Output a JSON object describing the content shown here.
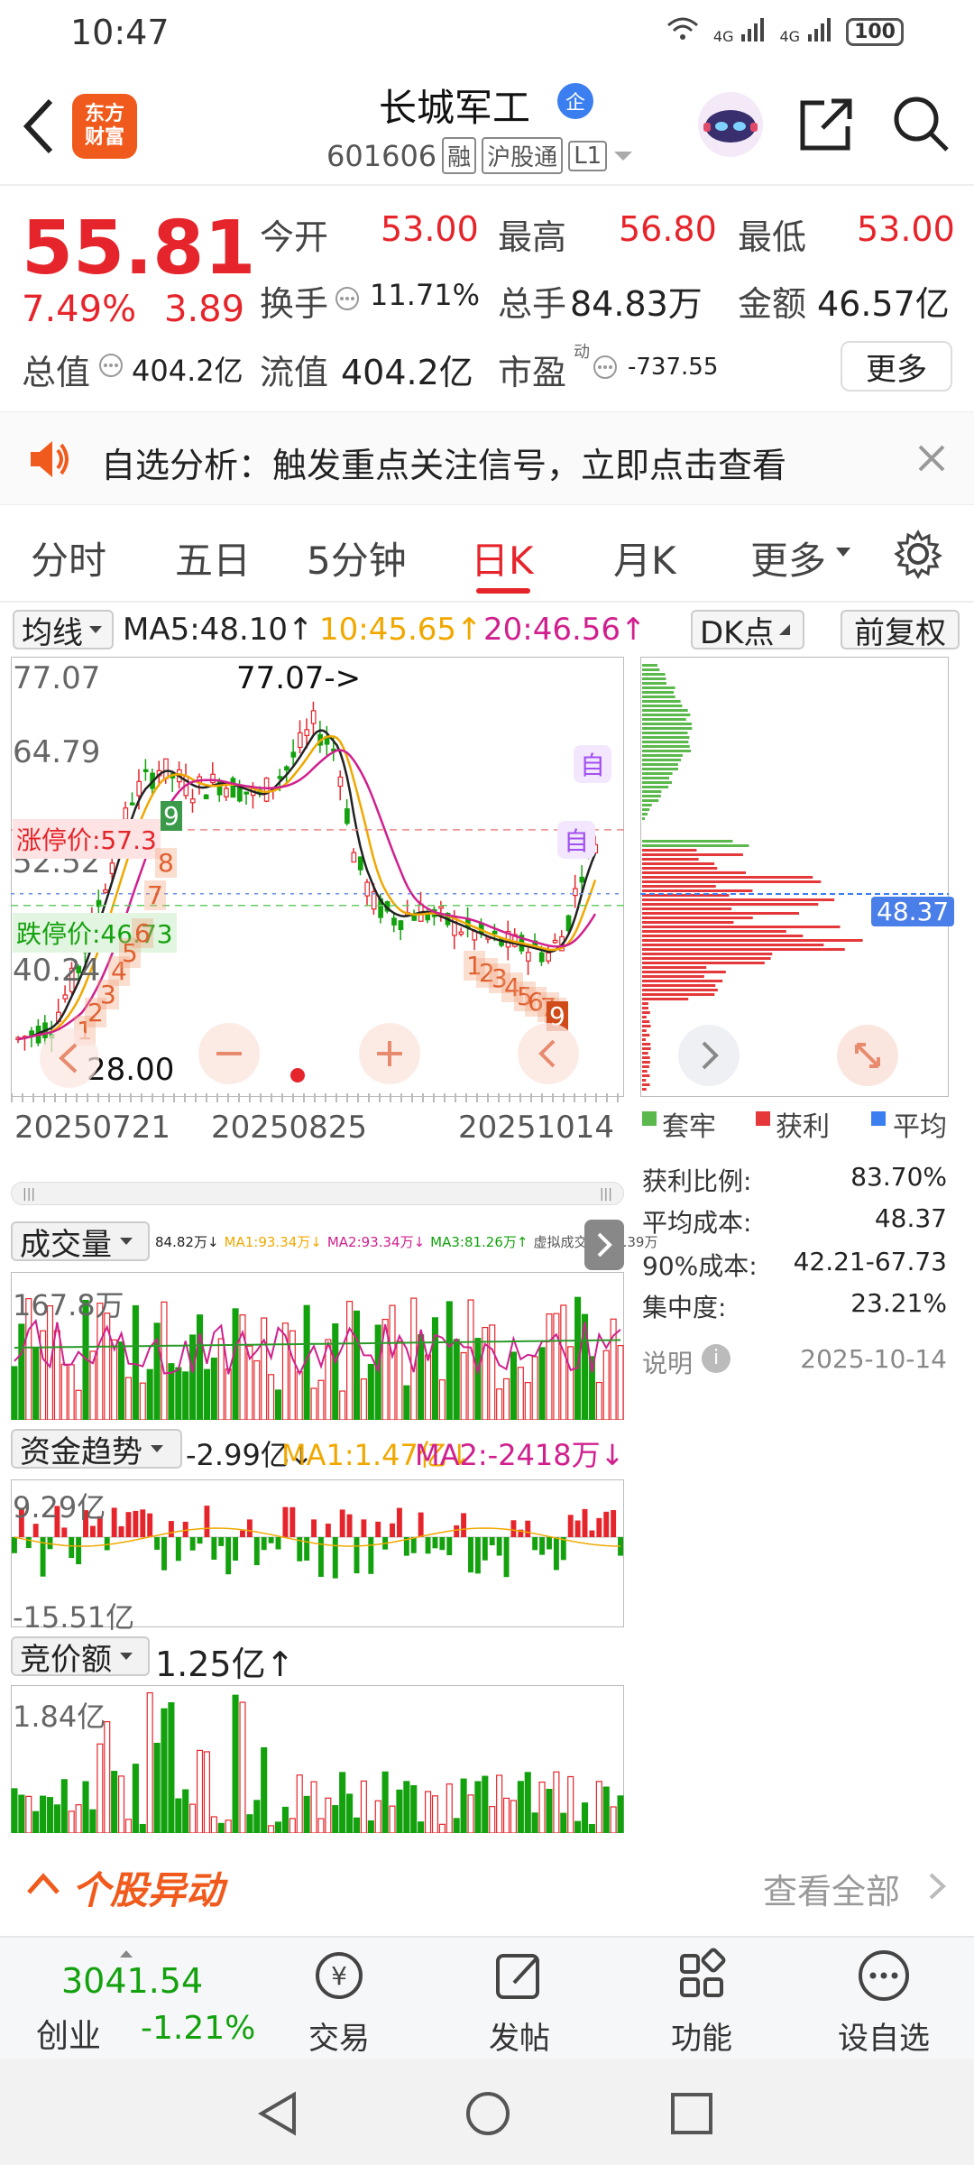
{
  "status_bar": {
    "time": "10:47",
    "battery": "100",
    "net1": "4G",
    "net2": "4G"
  },
  "header": {
    "logo_text": "东方财富",
    "name": "长城军工",
    "name_badge": "企",
    "code": "601606",
    "tags": [
      "融",
      "沪股通",
      "L1"
    ]
  },
  "quote": {
    "price": "55.81",
    "change_pct": "7.49%",
    "change": "3.89",
    "rows": [
      [
        {
          "label": "今开",
          "value": "53.00",
          "color": "red"
        },
        {
          "label": "最高",
          "value": "56.80",
          "color": "red"
        },
        {
          "label": "最低",
          "value": "53.00",
          "color": "red"
        }
      ],
      [
        {
          "label": "换手",
          "value": "11.71%",
          "color": "dark"
        },
        {
          "label": "总手",
          "value": "84.83万",
          "color": "dark"
        },
        {
          "label": "金额",
          "value": "46.57亿",
          "color": "dark"
        }
      ],
      [
        {
          "label": "总值",
          "value": "404.2亿",
          "color": "dark"
        },
        {
          "label": "流值",
          "value": "404.2亿",
          "color": "dark"
        },
        {
          "label": "市盈",
          "value": "-737.55",
          "color": "dark"
        }
      ]
    ],
    "pe_sup": "动",
    "more_label": "更多"
  },
  "alert": {
    "text": "自选分析：触发重点关注信号，立即点击查看"
  },
  "tabs": {
    "items": [
      "分时",
      "五日",
      "5分钟",
      "日K",
      "月K",
      "更多"
    ],
    "active": "日K"
  },
  "ma_row": {
    "selector": "均线",
    "ma5": "MA5:48.10↑",
    "ma10": "10:45.65↑",
    "ma20": "20:46.56↑",
    "dk_label": "DK点",
    "fq_label": "前复权",
    "colors": {
      "ma5": "#222222",
      "ma10": "#f0a800",
      "ma20": "#d0208e"
    }
  },
  "kline": {
    "y_labels": [
      "77.07",
      "64.79",
      "52.52",
      "40.24"
    ],
    "high_marker": "77.07->",
    "low_marker": "28.00",
    "limit_up": "涨停价:57.3",
    "limit_down": "跌停价:46.73",
    "x_labels": [
      "20250721",
      "20250825",
      "20251014"
    ],
    "self_marks": [
      "自",
      "自"
    ],
    "sequence_marks": [
      "1",
      "2",
      "3",
      "4",
      "5",
      "6",
      "7",
      "8",
      "9",
      "1",
      "2",
      "3",
      "4",
      "5",
      "6",
      "7",
      "8",
      "9"
    ]
  },
  "chips": {
    "avg_label": "48.37",
    "legend": [
      "套牢",
      "获利",
      "平均"
    ],
    "stats": [
      {
        "label": "获利比例:",
        "value": "83.70%"
      },
      {
        "label": "平均成本:",
        "value": "48.37"
      },
      {
        "label": "90%成本:",
        "value": "42.21-67.73"
      },
      {
        "label": "集中度:",
        "value": "23.21%"
      }
    ],
    "note_label": "说明",
    "date": "2025-10-14"
  },
  "volume": {
    "selector": "成交量",
    "info": [
      "84.82万↓",
      "MA1:93.34万↓",
      "MA2:93.34万↓",
      "MA3:81.26万↑",
      "虚拟成交量:88.39万"
    ],
    "max_label": "167.8万"
  },
  "fund": {
    "selector": "资金趋势",
    "value": "-2.99亿↓",
    "ma1": "MA1:1.47亿↓",
    "ma2": "MA2:-2418万↓",
    "max_label": "9.29亿",
    "min_label": "-15.51亿"
  },
  "bid": {
    "selector": "竞价额",
    "value": "1.25亿↑",
    "max_label": "1.84亿"
  },
  "movement": {
    "title": "个股异动",
    "link": "查看全部"
  },
  "bottom_nav": {
    "index_value": "3041.54",
    "index_name": "创业",
    "index_change": "-1.21%",
    "items": [
      "交易",
      "发帖",
      "功能",
      "设自选"
    ]
  }
}
